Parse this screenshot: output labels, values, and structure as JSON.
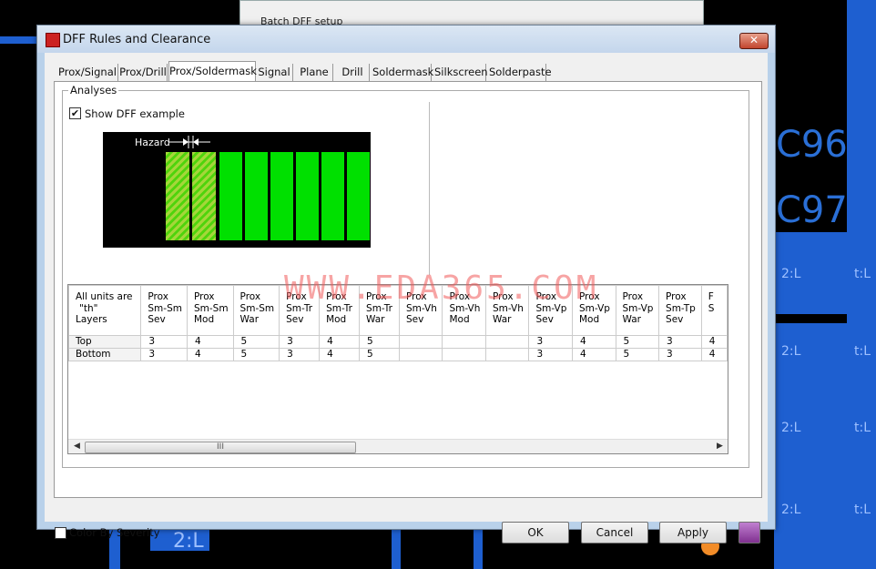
{
  "background": {
    "window_title": "Batch DFF setup",
    "pcb_labels": [
      "C96",
      "C97",
      "2:L",
      "t:L",
      "2:L",
      "t:L",
      "2:L",
      "t:L",
      "2:L",
      "t:L",
      "2:L"
    ]
  },
  "dialog": {
    "title": "DFF Rules and Clearance",
    "close_label": "✕",
    "tabs": [
      {
        "label": "Prox/Signal",
        "active": false
      },
      {
        "label": "Prox/Drill",
        "active": false
      },
      {
        "label": "Prox/Soldermask",
        "active": true
      },
      {
        "label": "Signal",
        "active": false
      },
      {
        "label": "Plane",
        "active": false
      },
      {
        "label": "Drill",
        "active": false
      },
      {
        "label": "Soldermask",
        "active": false
      },
      {
        "label": "Silkscreen",
        "active": false
      },
      {
        "label": "Solderpaste",
        "active": false
      }
    ],
    "analyses_label": "Analyses",
    "show_example": {
      "label": "Show DFF example",
      "checked": true
    },
    "example": {
      "hazard_label": "Hazard"
    },
    "grid": {
      "corner_header": [
        "All units are",
        "\"th\"",
        "Layers"
      ],
      "columns": [
        [
          "Prox",
          "Sm-Sm",
          "Sev"
        ],
        [
          "Prox",
          "Sm-Sm",
          "Mod"
        ],
        [
          "Prox",
          "Sm-Sm",
          "War"
        ],
        [
          "Prox",
          "Sm-Tr",
          "Sev"
        ],
        [
          "Prox",
          "Sm-Tr",
          "Mod"
        ],
        [
          "Prox",
          "Sm-Tr",
          "War"
        ],
        [
          "Prox",
          "Sm-Vh",
          "Sev"
        ],
        [
          "Prox",
          "Sm-Vh",
          "Mod"
        ],
        [
          "Prox",
          "Sm-Vh",
          "War"
        ],
        [
          "Prox",
          "Sm-Vp",
          "Sev"
        ],
        [
          "Prox",
          "Sm-Vp",
          "Mod"
        ],
        [
          "Prox",
          "Sm-Vp",
          "War"
        ],
        [
          "Prox",
          "Sm-Tp",
          "Sev"
        ],
        [
          "F",
          "S",
          ""
        ]
      ],
      "rows": [
        {
          "layer": "Top",
          "values": [
            "3",
            "4",
            "5",
            "3",
            "4",
            "5",
            "",
            "",
            "",
            "3",
            "4",
            "5",
            "3",
            "4"
          ]
        },
        {
          "layer": "Bottom",
          "values": [
            "3",
            "4",
            "5",
            "3",
            "4",
            "5",
            "",
            "",
            "",
            "3",
            "4",
            "5",
            "3",
            "4"
          ]
        }
      ],
      "scroll_thumb": "III"
    },
    "color_by_severity": {
      "label": "Color By Severity",
      "checked": false
    },
    "buttons": {
      "ok": "OK",
      "cancel": "Cancel",
      "apply": "Apply"
    }
  },
  "watermark": "WWW.EDA365.COM"
}
